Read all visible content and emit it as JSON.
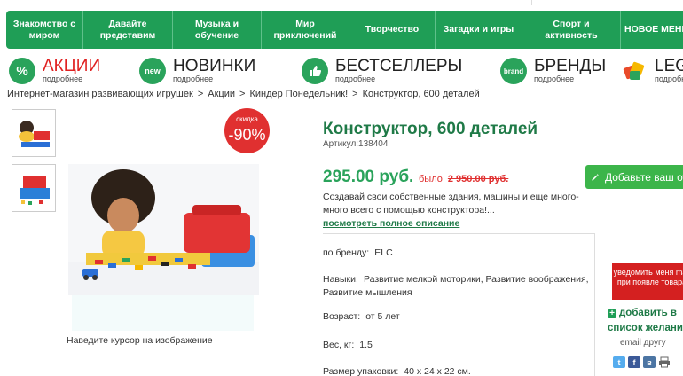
{
  "nav": {
    "items": [
      {
        "label": "Знакомство с миром"
      },
      {
        "label": "Давайте представим"
      },
      {
        "label": "Музыка и обучение"
      },
      {
        "label": "Мир приключений"
      },
      {
        "label": "Творчество"
      },
      {
        "label": "Загадки и игры"
      },
      {
        "label": "Спорт и активность"
      },
      {
        "label": "НОВОЕ МЕНЮ"
      }
    ]
  },
  "promos": [
    {
      "title": "АКЦИИ",
      "sub": "подробнее",
      "icon": "percent-icon",
      "glyph": "%",
      "color": "#2aa35b",
      "title_color": "#e02020"
    },
    {
      "title": "НОВИНКИ",
      "sub": "подробнее",
      "icon": "new-icon",
      "glyph": "new",
      "color": "#2aa35b",
      "title_color": "#222222"
    },
    {
      "title": "БЕСТСЕЛЛЕРЫ",
      "sub": "подробнее",
      "icon": "thumbs-up-icon",
      "glyph": "👍",
      "color": "#2aa35b",
      "title_color": "#222222"
    },
    {
      "title": "БРЕНДЫ",
      "sub": "подробнее",
      "icon": "brand-icon",
      "glyph": "brand",
      "color": "#2aa35b",
      "title_color": "#222222"
    },
    {
      "title": "LEG",
      "sub": "подробне",
      "icon": "lego-bricks-icon",
      "glyph": "",
      "color": "#e05a2a",
      "title_color": "#222222"
    }
  ],
  "breadcrumb": {
    "home": "Интернет-магазин развивающих игрушек",
    "cat1": "Акции",
    "cat2": "Киндер Понедельник!",
    "current": "Конструктор, 600 деталей",
    "sep": ">"
  },
  "product": {
    "title": "Конструктор, 600 деталей",
    "sku": "Артикул:138404",
    "price": "295.00 руб.",
    "old_label": "было",
    "old_price": "2 950.00 руб.",
    "discount_label": "скидка",
    "discount": "-90%",
    "add_to_cart": "Добавьте ваш от",
    "description": "Создавай свои собственные здания, машины и еще много-много всего с помощью конструктора!...",
    "full_desc_link": "посмотреть полное описание",
    "hover_hint": "Наведите курсор на изображение"
  },
  "attributes": [
    {
      "name": "по бренду:",
      "value": "ELC"
    },
    {
      "name": "Навыки:",
      "value": "Развитие мелкой моторики, Развитие воображения, Развитие мышления"
    },
    {
      "name": "Возраст:",
      "value": "от 5 лет"
    },
    {
      "name": "Вес, кг:",
      "value": "1.5"
    },
    {
      "name": "Размер упаковки:",
      "value": "40 х 24 х 22 см."
    }
  ],
  "side": {
    "notify": "уведомить меня mail при появле товара",
    "wishlist": "добавить в список желани",
    "email_friend": "email другу"
  },
  "social": [
    {
      "name": "twitter-icon",
      "glyph": "t",
      "color": "#55acee"
    },
    {
      "name": "facebook-icon",
      "glyph": "f",
      "color": "#3b5998"
    },
    {
      "name": "vkontakte-icon",
      "glyph": "в",
      "color": "#4c75a3"
    },
    {
      "name": "print-icon",
      "glyph": "🖶",
      "color": "#777777"
    }
  ]
}
